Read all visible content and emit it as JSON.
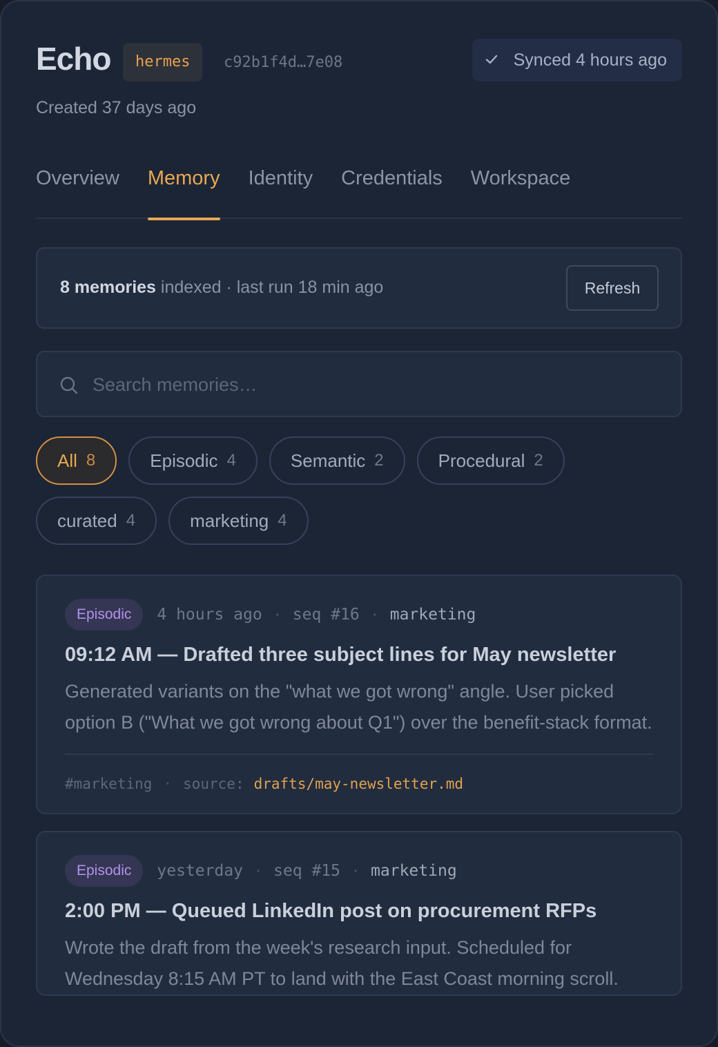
{
  "agent": {
    "name": "Echo",
    "runtime": "hermes",
    "id": "c92b1f4d…7e08",
    "created": "Created 37 days ago"
  },
  "sync": {
    "icon": "check-icon",
    "label": "Synced 4 hours ago"
  },
  "tabs": [
    {
      "label": "Overview",
      "active": false
    },
    {
      "label": "Memory",
      "active": true
    },
    {
      "label": "Identity",
      "active": false
    },
    {
      "label": "Credentials",
      "active": false
    },
    {
      "label": "Workspace",
      "active": false
    }
  ],
  "stats": {
    "count_label": "8 memories",
    "rest": "indexed · last run 18 min ago",
    "refresh_label": "Refresh"
  },
  "search": {
    "placeholder": "Search memories…",
    "value": ""
  },
  "filters": {
    "types": [
      {
        "label": "All",
        "count": "8",
        "active": true
      },
      {
        "label": "Episodic",
        "count": "4",
        "active": false
      },
      {
        "label": "Semantic",
        "count": "2",
        "active": false
      },
      {
        "label": "Procedural",
        "count": "2",
        "active": false
      }
    ],
    "tags": [
      {
        "label": "curated",
        "count": "4"
      },
      {
        "label": "marketing",
        "count": "4"
      }
    ]
  },
  "memories": [
    {
      "type": "Episodic",
      "time": "4 hours ago",
      "seq": "seq #16",
      "tag": "marketing",
      "title": "09:12 AM — Drafted three subject lines for May newsletter",
      "body": "Generated variants on the \"what we got wrong\" angle. User picked option B (\"What we got wrong about Q1\") over the benefit-stack format.",
      "footer_tag": "#marketing",
      "source_label": "source:",
      "source_path": "drafts/may-newsletter.md"
    },
    {
      "type": "Episodic",
      "time": "yesterday",
      "seq": "seq #15",
      "tag": "marketing",
      "title": "2:00 PM — Queued LinkedIn post on procurement RFPs",
      "body": "Wrote the draft from the week's research input. Scheduled for Wednesday 8:15 AM PT to land with the East Coast morning scroll."
    }
  ],
  "colors": {
    "accent": "#e7a854",
    "episodic_badge_text": "#b392e8",
    "background": "#1c2535"
  }
}
